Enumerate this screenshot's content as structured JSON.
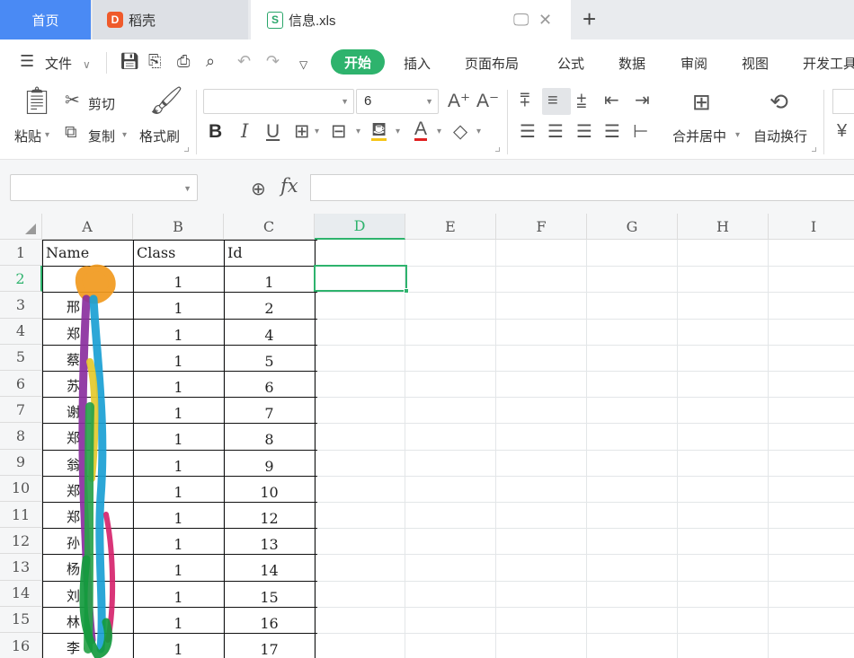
{
  "tabs": {
    "home": "首页",
    "daoke": "稻壳",
    "daoke_logo": "D",
    "doc": "信息.xls",
    "doc_logo": "S",
    "add": "+"
  },
  "menu": {
    "file": "文件",
    "start": "开始",
    "items": [
      "插入",
      "页面布局",
      "公式",
      "数据",
      "审阅",
      "视图",
      "开发工具"
    ]
  },
  "ribbon": {
    "paste": "粘贴",
    "cut": "剪切",
    "copy": "复制",
    "format_painter": "格式刷",
    "font_name": "",
    "font_size": "6",
    "merge_center": "合并居中",
    "wrap_text": "自动换行"
  },
  "formula_bar": {
    "name_box": "",
    "formula": ""
  },
  "grid": {
    "columns": [
      "A",
      "B",
      "C",
      "D",
      "E",
      "F",
      "G",
      "H",
      "I"
    ],
    "active_column": "D",
    "active_row": "2",
    "headers": [
      "Name",
      "Class",
      "Id"
    ],
    "rows": [
      {
        "row": "2",
        "name": "",
        "class": "1",
        "id": "1"
      },
      {
        "row": "3",
        "name": "邢",
        "class": "1",
        "id": "2"
      },
      {
        "row": "4",
        "name": "郑",
        "class": "1",
        "id": "4"
      },
      {
        "row": "5",
        "name": "蔡",
        "class": "1",
        "id": "5"
      },
      {
        "row": "6",
        "name": "苏",
        "class": "1",
        "id": "6"
      },
      {
        "row": "7",
        "name": "谢",
        "class": "1",
        "id": "7"
      },
      {
        "row": "8",
        "name": "郑",
        "class": "1",
        "id": "8"
      },
      {
        "row": "9",
        "name": "翁",
        "class": "1",
        "id": "9"
      },
      {
        "row": "10",
        "name": "郑",
        "class": "1",
        "id": "10"
      },
      {
        "row": "11",
        "name": "郑",
        "class": "1",
        "id": "12"
      },
      {
        "row": "12",
        "name": "孙",
        "class": "1",
        "id": "13"
      },
      {
        "row": "13",
        "name": "杨",
        "class": "1",
        "id": "14"
      },
      {
        "row": "14",
        "name": "刘",
        "class": "1",
        "id": "15"
      },
      {
        "row": "15",
        "name": "林",
        "class": "1",
        "id": "16"
      },
      {
        "row": "16",
        "name": "李",
        "class": "1",
        "id": "17"
      }
    ]
  },
  "colors": {
    "accent": "#2eb36d",
    "home_tab": "#4a8af4",
    "daoke_logo": "#ef5a2b"
  }
}
